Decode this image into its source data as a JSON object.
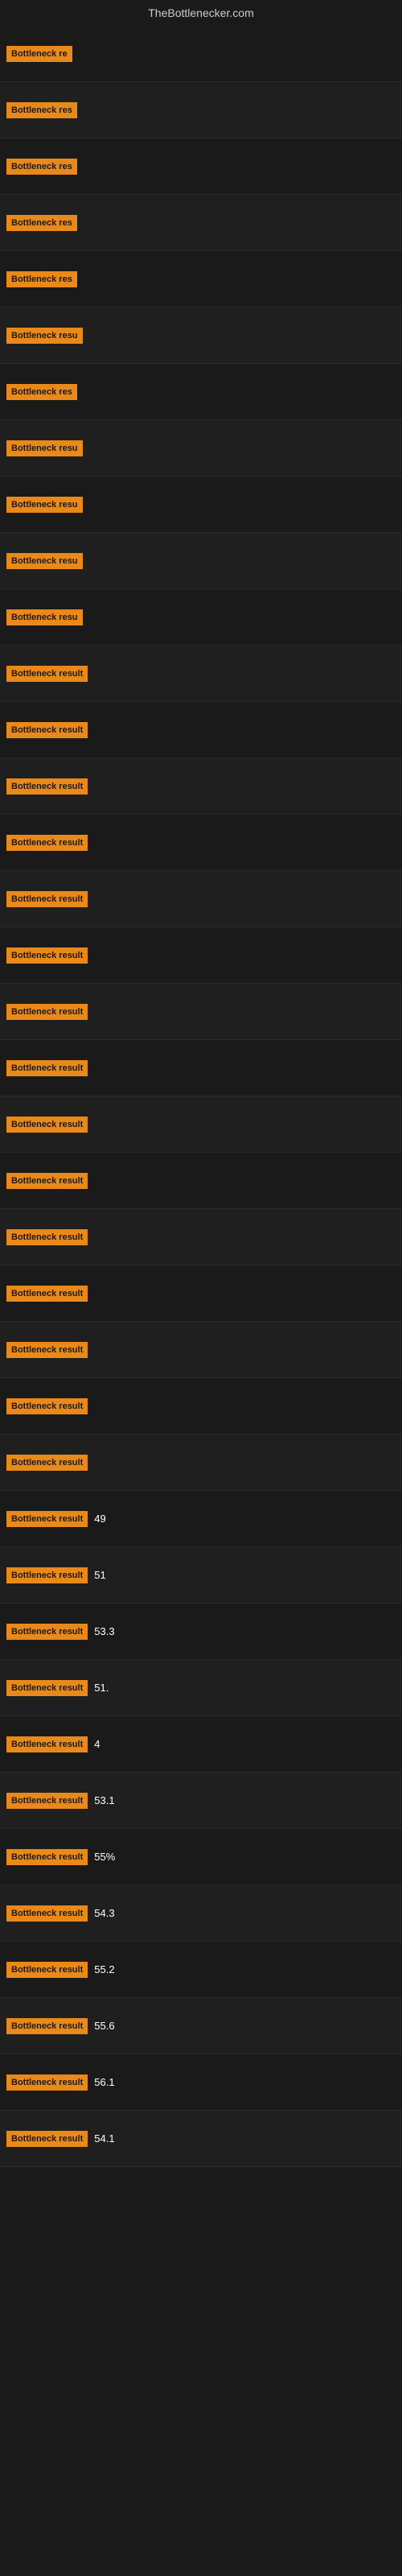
{
  "site": {
    "title": "TheBottlenecker.com"
  },
  "rows": [
    {
      "label": "Bottleneck re",
      "value": ""
    },
    {
      "label": "Bottleneck res",
      "value": ""
    },
    {
      "label": "Bottleneck res",
      "value": ""
    },
    {
      "label": "Bottleneck res",
      "value": ""
    },
    {
      "label": "Bottleneck res",
      "value": ""
    },
    {
      "label": "Bottleneck resu",
      "value": ""
    },
    {
      "label": "Bottleneck res",
      "value": ""
    },
    {
      "label": "Bottleneck resu",
      "value": ""
    },
    {
      "label": "Bottleneck resu",
      "value": ""
    },
    {
      "label": "Bottleneck resu",
      "value": ""
    },
    {
      "label": "Bottleneck resu",
      "value": ""
    },
    {
      "label": "Bottleneck result",
      "value": ""
    },
    {
      "label": "Bottleneck result",
      "value": ""
    },
    {
      "label": "Bottleneck result",
      "value": ""
    },
    {
      "label": "Bottleneck result",
      "value": ""
    },
    {
      "label": "Bottleneck result",
      "value": ""
    },
    {
      "label": "Bottleneck result",
      "value": ""
    },
    {
      "label": "Bottleneck result",
      "value": ""
    },
    {
      "label": "Bottleneck result",
      "value": ""
    },
    {
      "label": "Bottleneck result",
      "value": ""
    },
    {
      "label": "Bottleneck result",
      "value": ""
    },
    {
      "label": "Bottleneck result",
      "value": ""
    },
    {
      "label": "Bottleneck result",
      "value": ""
    },
    {
      "label": "Bottleneck result",
      "value": ""
    },
    {
      "label": "Bottleneck result",
      "value": ""
    },
    {
      "label": "Bottleneck result",
      "value": ""
    },
    {
      "label": "Bottleneck result",
      "value": "49"
    },
    {
      "label": "Bottleneck result",
      "value": "51"
    },
    {
      "label": "Bottleneck result",
      "value": "53.3"
    },
    {
      "label": "Bottleneck result",
      "value": "51."
    },
    {
      "label": "Bottleneck result",
      "value": "4"
    },
    {
      "label": "Bottleneck result",
      "value": "53.1"
    },
    {
      "label": "Bottleneck result",
      "value": "55%"
    },
    {
      "label": "Bottleneck result",
      "value": "54.3"
    },
    {
      "label": "Bottleneck result",
      "value": "55.2"
    },
    {
      "label": "Bottleneck result",
      "value": "55.6"
    },
    {
      "label": "Bottleneck result",
      "value": "56.1"
    },
    {
      "label": "Bottleneck result",
      "value": "54.1"
    }
  ]
}
